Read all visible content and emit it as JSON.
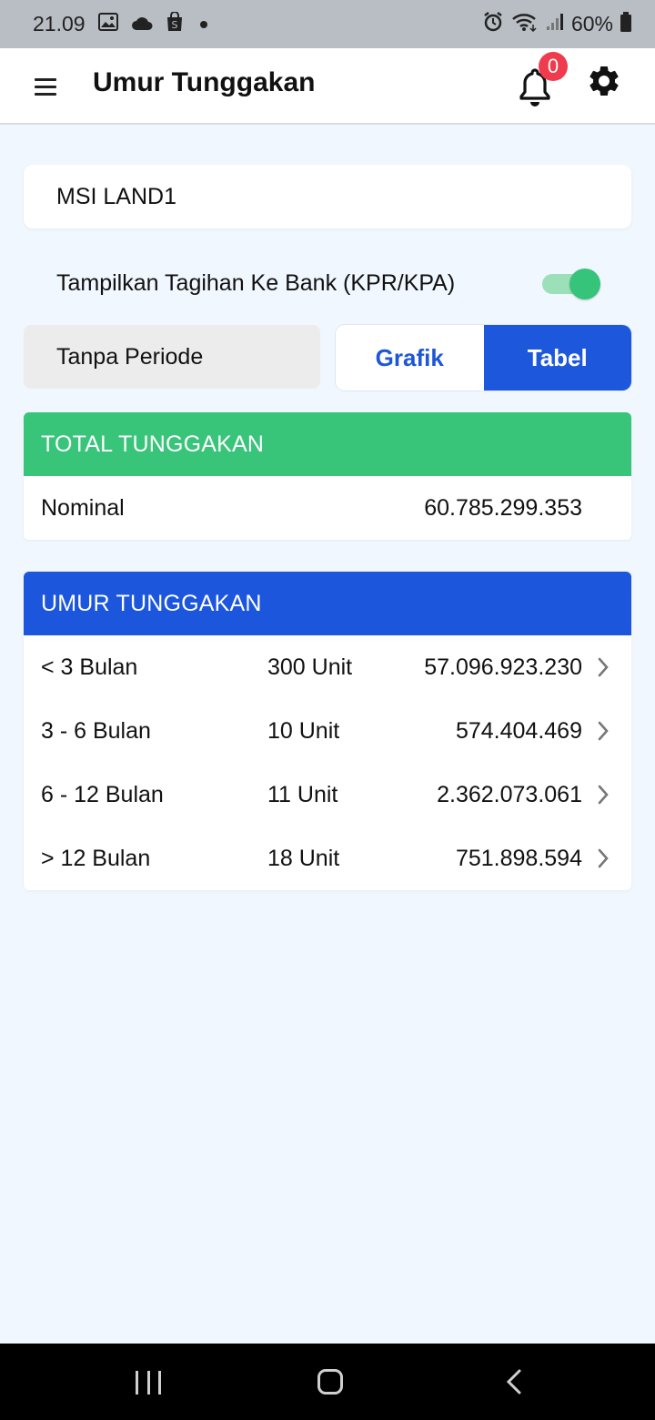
{
  "status_bar": {
    "time": "21.09",
    "battery": "60%"
  },
  "header": {
    "title": "Umur Tunggakan",
    "notification_count": "0"
  },
  "project": {
    "name": "MSI LAND1"
  },
  "toggle": {
    "label": "Tampilkan Tagihan Ke Bank (KPR/KPA)",
    "on": true
  },
  "period": {
    "value": "Tanpa Periode"
  },
  "view_tabs": [
    {
      "label": "Grafik",
      "active": false
    },
    {
      "label": "Tabel",
      "active": true
    }
  ],
  "total_section": {
    "header": "TOTAL TUNGGAKAN",
    "label": "Nominal",
    "value": "60.785.299.353"
  },
  "aging_section": {
    "header": "UMUR TUNGGAKAN",
    "rows": [
      {
        "period": "< 3 Bulan",
        "units": "300 Unit",
        "amount": "57.096.923.230"
      },
      {
        "period": "3 - 6 Bulan",
        "units": "10 Unit",
        "amount": "574.404.469"
      },
      {
        "period": "6 - 12 Bulan",
        "units": "11 Unit",
        "amount": "2.362.073.061"
      },
      {
        "period": "> 12 Bulan",
        "units": "18 Unit",
        "amount": "751.898.594"
      }
    ]
  },
  "colors": {
    "accent_blue": "#1b56dc",
    "accent_green": "#38c479",
    "badge_red": "#ef3b4d",
    "background": "#f0f7fe"
  },
  "icons": {
    "menu": "menu-icon",
    "notifications": "bell-icon",
    "settings": "gear-icon",
    "row_action": "chevron-right-icon"
  }
}
